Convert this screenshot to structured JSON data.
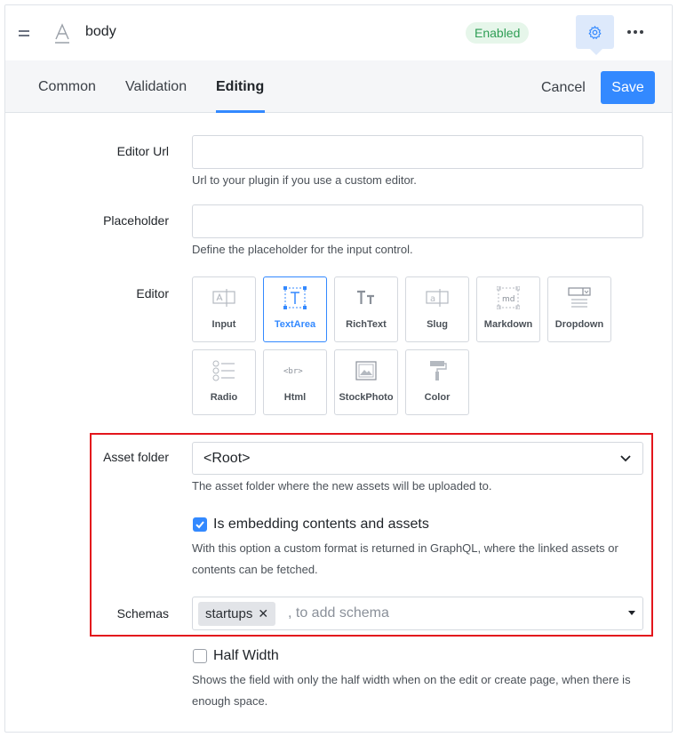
{
  "header": {
    "field_name": "body",
    "status": "Enabled",
    "colors": {
      "accent": "#3389ff",
      "enabled_bg": "#e6f6ea",
      "enabled_fg": "#2f9e55"
    }
  },
  "tabs": [
    {
      "label": "Common"
    },
    {
      "label": "Validation"
    },
    {
      "label": "Editing",
      "active": true
    }
  ],
  "actions": {
    "cancel": "Cancel",
    "save": "Save"
  },
  "form": {
    "editor_url": {
      "label": "Editor Url",
      "value": "",
      "placeholder": "",
      "hint": "Url to your plugin if you use a custom editor."
    },
    "placeholder": {
      "label": "Placeholder",
      "value": "",
      "placeholder": "",
      "hint": "Define the placeholder for the input control."
    },
    "editor": {
      "label": "Editor",
      "options": [
        {
          "label": "Input",
          "icon": "input-icon"
        },
        {
          "label": "TextArea",
          "icon": "textarea-icon",
          "selected": true
        },
        {
          "label": "RichText",
          "icon": "richtext-icon"
        },
        {
          "label": "Slug",
          "icon": "slug-icon"
        },
        {
          "label": "Markdown",
          "icon": "markdown-icon"
        },
        {
          "label": "Dropdown",
          "icon": "dropdown-icon"
        },
        {
          "label": "Radio",
          "icon": "radio-icon"
        },
        {
          "label": "Html",
          "icon": "html-icon"
        },
        {
          "label": "StockPhoto",
          "icon": "stockphoto-icon"
        },
        {
          "label": "Color",
          "icon": "color-icon"
        }
      ]
    },
    "asset_folder": {
      "label": "Asset folder",
      "value": "<Root>",
      "hint": "The asset folder where the new assets will be uploaded to."
    },
    "embedding": {
      "checked": true,
      "label": "Is embedding contents and assets",
      "hint": "With this option a custom format is returned in GraphQL, where the linked assets or contents can be fetched."
    },
    "schemas": {
      "label": "Schemas",
      "tags": [
        "startups"
      ],
      "placeholder": ", to add schema"
    },
    "half_width": {
      "checked": false,
      "label": "Half Width",
      "hint": "Shows the field with only the half width when on the edit or create page, when there is enough space."
    }
  }
}
